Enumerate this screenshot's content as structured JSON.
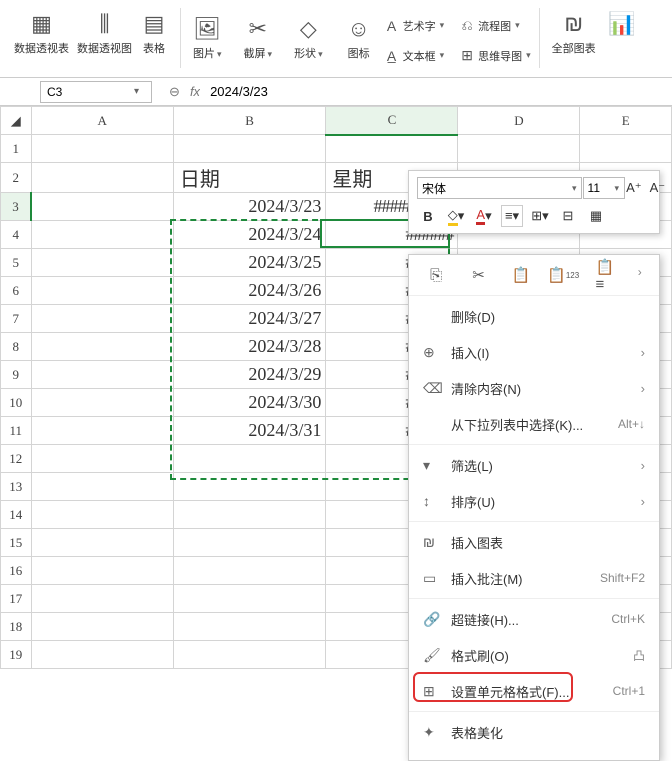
{
  "ribbon": {
    "pivot_table": "数据透视表",
    "pivot_chart": "数据透视图",
    "table": "表格",
    "picture": "图片",
    "screenshot": "截屏",
    "shapes": "形状",
    "icons": "图标",
    "wordart": "艺术字",
    "textbox": "文本框",
    "flowchart": "流程图",
    "mindmap": "思维导图",
    "allcharts": "全部图表"
  },
  "namebox": "C3",
  "formula": "2024/3/23",
  "columns": [
    "A",
    "B",
    "C",
    "D",
    "E"
  ],
  "rows_count": 19,
  "headers": {
    "b2": "日期",
    "c2": "星期"
  },
  "data_b": [
    "2024/3/23",
    "2024/3/24",
    "2024/3/25",
    "2024/3/26",
    "2024/3/27",
    "2024/3/28",
    "2024/3/29",
    "2024/3/30",
    "2024/3/31"
  ],
  "data_c_full": "##########",
  "data_c_clip": "######",
  "mini": {
    "font": "宋体",
    "size": "11"
  },
  "ctx": {
    "delete": "删除(D)",
    "insert": "插入(I)",
    "clear": "清除内容(N)",
    "dropdown": "从下拉列表中选择(K)...",
    "dropdown_sc": "Alt+↓",
    "filter": "筛选(L)",
    "sort": "排序(U)",
    "insert_chart": "插入图表",
    "insert_comment": "插入批注(M)",
    "insert_comment_sc": "Shift+F2",
    "hyperlink": "超链接(H)...",
    "hyperlink_sc": "Ctrl+K",
    "format_painter": "格式刷(O)",
    "format_cells": "设置单元格格式(F)...",
    "format_cells_sc": "Ctrl+1",
    "beautify": "表格美化"
  }
}
